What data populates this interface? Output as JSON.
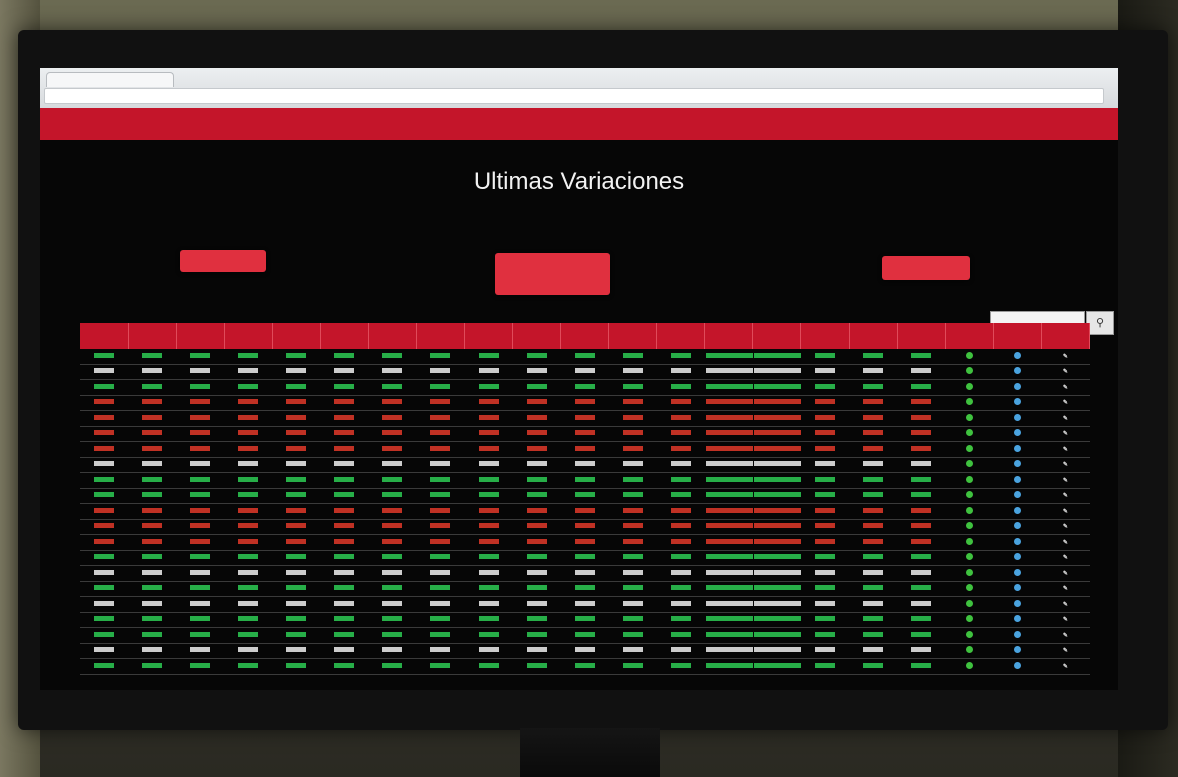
{
  "page": {
    "title": "Ultimas Variaciones"
  },
  "browser": {
    "tab_label": "",
    "url": ""
  },
  "navbar": {
    "items": [
      "",
      "",
      "",
      ""
    ],
    "user": "",
    "exit": "",
    "bg_color": "#c4152a"
  },
  "buttons": {
    "left": "",
    "center_line1": "",
    "center_line2": "",
    "right": ""
  },
  "search": {
    "placeholder": "",
    "button_icon": "search-icon"
  },
  "table": {
    "columns": [
      "",
      "",
      "",
      "",
      "",
      "",
      "",
      "",
      "",
      "",
      "",
      "",
      "",
      "",
      "",
      "",
      "",
      "",
      "",
      "",
      ""
    ],
    "row_colors": [
      "g",
      "w",
      "g",
      "r",
      "r",
      "r",
      "r",
      "w",
      "g",
      "g",
      "r",
      "r",
      "r",
      "g",
      "w",
      "g",
      "w",
      "g",
      "g",
      "w",
      "g"
    ],
    "status_colors": {
      "g": "#2ecc55",
      "r": "#e23a2a",
      "w": "#f0f0f0"
    }
  },
  "footer": {
    "note": ""
  }
}
